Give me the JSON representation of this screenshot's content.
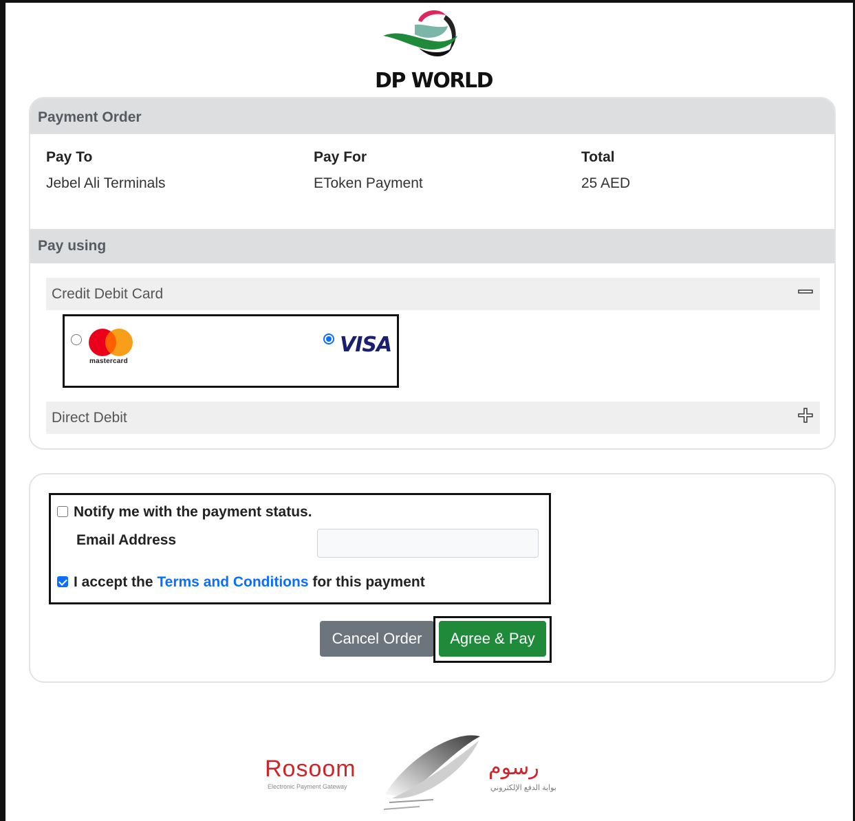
{
  "brand": {
    "name": "DP WORLD",
    "logo_icon": "dp-world-swoosh-icon"
  },
  "payment_order": {
    "header": "Payment Order",
    "columns": [
      {
        "label": "Pay To",
        "value": "Jebel Ali Terminals"
      },
      {
        "label": "Pay For",
        "value": "EToken Payment"
      },
      {
        "label": "Total",
        "value": "25 AED"
      }
    ]
  },
  "pay_using": {
    "header": "Pay using",
    "credit_debit": {
      "label": "Credit Debit Card",
      "toggle": "minus-icon",
      "expanded": true
    },
    "card_options": [
      {
        "brand": "mastercard",
        "text": "mastercard",
        "selected": false
      },
      {
        "brand": "visa",
        "text": "VISA",
        "selected": true
      }
    ],
    "direct_debit": {
      "label": "Direct Debit",
      "toggle": "plus-icon",
      "expanded": false
    }
  },
  "notification": {
    "notify_label": "Notify me with the payment status.",
    "notify_checked": false,
    "email_label": "Email Address",
    "email_value": "",
    "terms_prefix": "I accept the ",
    "terms_link": "Terms and Conditions",
    "terms_suffix": " for this payment",
    "terms_checked": true
  },
  "actions": {
    "cancel_label": "Cancel Order",
    "pay_label": "Agree & Pay"
  },
  "footer": {
    "rosoom_en": "Rosoom",
    "rosoom_en_sub": "Electronic Payment Gateway",
    "rosoom_ar": "رسوم",
    "rosoom_ar_sub": "بوابة الدفع الإلكتروني"
  },
  "colors": {
    "accent": "#0d6efd",
    "pay_button": "#1e8a3a",
    "cancel_button": "#6c757d",
    "rosoom_red": "#d0242b"
  }
}
